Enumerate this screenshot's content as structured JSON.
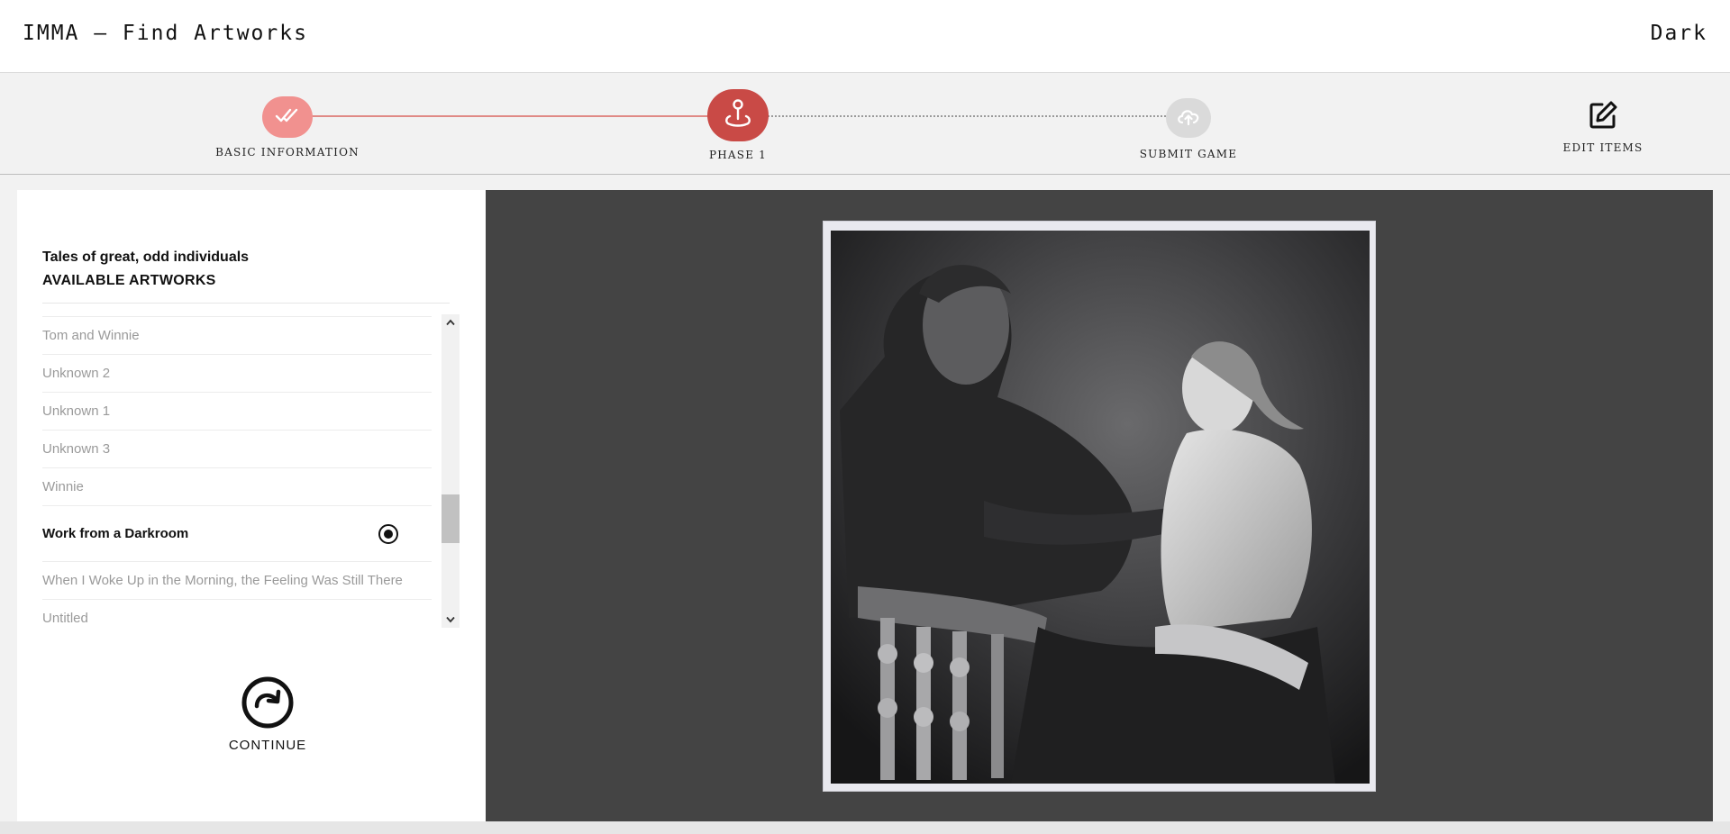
{
  "app": {
    "title": "IMMA – Find Artworks",
    "theme_toggle": "Dark"
  },
  "stepper": {
    "steps": [
      {
        "label": "BASIC INFORMATION",
        "icon": "double-check-icon",
        "state": "done"
      },
      {
        "label": "PHASE 1",
        "icon": "location-pin-icon",
        "state": "current"
      },
      {
        "label": "SUBMIT GAME",
        "icon": "cloud-upload-icon",
        "state": "todo"
      },
      {
        "label": "EDIT ITEMS",
        "icon": "edit-icon",
        "state": "action"
      }
    ],
    "colors": {
      "done": "#f1918f",
      "current": "#c94a46",
      "todo": "#dadada"
    }
  },
  "panel": {
    "title": "Tales of great, odd individuals",
    "subtitle": "AVAILABLE ARTWORKS",
    "artworks": [
      {
        "label": "Tom and Winnie",
        "selected": false
      },
      {
        "label": "Unknown 2",
        "selected": false
      },
      {
        "label": "Unknown 1",
        "selected": false
      },
      {
        "label": "Unknown 3",
        "selected": false
      },
      {
        "label": "Winnie",
        "selected": false
      },
      {
        "label": "Work from a Darkroom",
        "selected": true
      },
      {
        "label": "When I Woke Up in the Morning, the Feeling Was Still There",
        "selected": false
      },
      {
        "label": "Untitled",
        "selected": false
      }
    ],
    "continue_label": "CONTINUE"
  },
  "viewer": {
    "artwork_alt": "Work from a Darkroom"
  }
}
